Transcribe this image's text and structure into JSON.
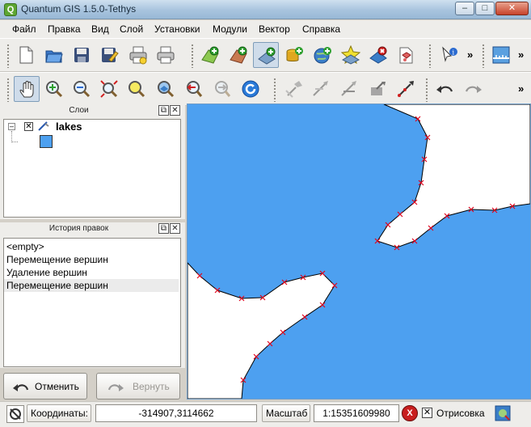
{
  "window": {
    "title": "Quantum GIS 1.5.0-Tethys",
    "minimize": "–",
    "maximize": "□",
    "close": "✕"
  },
  "menu": {
    "items": [
      "Файл",
      "Правка",
      "Вид",
      "Слой",
      "Установки",
      "Модули",
      "Вектор",
      "Справка"
    ]
  },
  "toolbar1": {
    "overflow": "»",
    "overflow2": "»",
    "icons": [
      "new-project-icon",
      "open-project-icon",
      "save-project-icon",
      "save-as-icon",
      "print-composer-icon",
      "print-icon",
      "add-raster-layer-icon",
      "add-wms-layer-icon",
      "add-vector-layer-icon",
      "add-postgis-layer-icon",
      "add-wfs-layer-icon",
      "add-spatialite-layer-icon",
      "remove-layer-icon",
      "new-vector-layer-icon",
      "identify-icon",
      "measure-icon"
    ]
  },
  "toolbar2": {
    "overflow": "»",
    "icons": [
      "pan-icon",
      "zoom-in-icon",
      "zoom-out-icon",
      "zoom-full-icon",
      "zoom-to-selection-icon",
      "zoom-to-layer-icon",
      "zoom-last-icon",
      "zoom-next-icon",
      "refresh-icon",
      "move-feature-icon",
      "split-features-icon",
      "delete-part-icon",
      "reshape-icon",
      "node-tool-icon",
      "undo-icon",
      "redo-icon"
    ]
  },
  "layers_panel": {
    "title": "Слои",
    "layers": [
      {
        "name": "lakes",
        "visible": true,
        "symbol_color": "#4da0f0"
      }
    ]
  },
  "history_panel": {
    "title": "История правок",
    "items": [
      "<empty>",
      "Перемещение вершин",
      "Удаление вершин",
      "Перемещение вершин"
    ],
    "selected_index": 3
  },
  "buttons": {
    "undo": "Отменить",
    "redo": "Вернуть"
  },
  "status": {
    "coords_label": "Координаты:",
    "coords_value": "-314907,3114662",
    "scale_label": "Масштаб",
    "scale_value": "1:15351609980",
    "render_label": "Отрисовка",
    "render_checked": true
  },
  "map": {
    "water_color": "#4da0f0",
    "land_color": "#ffffff",
    "vertex_color": "#e0001a"
  }
}
